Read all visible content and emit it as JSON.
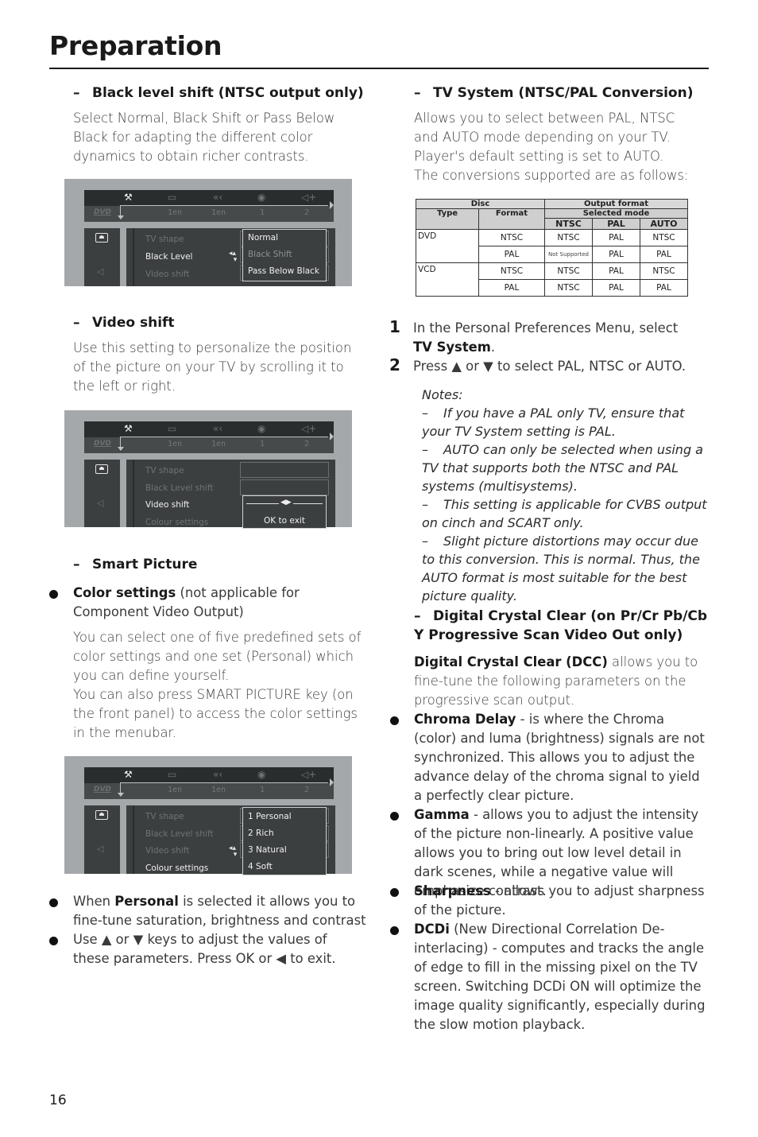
{
  "header": {
    "title": "Preparation"
  },
  "left": {
    "black_level": {
      "heading": "Black level shift (NTSC output only)",
      "body": "Select Normal, Black Shift or Pass Below Black for adapting the different color dynamics to obtain richer contrasts."
    },
    "video_shift": {
      "heading": "Video shift",
      "body": "Use this setting to personalize the position of the picture on your TV by scrolling it to the left or right."
    },
    "smart_picture": {
      "heading": "Smart Picture",
      "bullet_bold": "Color settings",
      "bullet_rest": " (not applicable for Component Video Output)",
      "body1": "You can select one of five predefined sets of color settings and one set (Personal) which you can define yourself.",
      "body2": "You can also press SMART PICTURE key (on the front panel) to access the color settings in the menubar."
    },
    "bullets": [
      {
        "pre": "When ",
        "bold": "Personal",
        "post": " is selected it allows you to fine-tune saturation, brightness and contrast"
      },
      {
        "pre": "Use ▲ or ▼ keys to adjust the values of these parameters. Press OK or ◀ to exit.",
        "bold": "",
        "post": ""
      }
    ]
  },
  "osd": {
    "menubar_icons": [
      "settings-icon",
      "subtitle-icon",
      "audio-language-icon",
      "angle-icon",
      "audio-output-icon"
    ],
    "menubar_values": [
      "1en",
      "1en",
      "1",
      "2"
    ],
    "disc_label": "DVD",
    "screen1": {
      "items": [
        "TV shape",
        "Black Level",
        "Video shift"
      ],
      "selected_index": 1,
      "options": [
        "Normal",
        "Black Shift",
        "Pass Below Black"
      ],
      "highlighted_option": 1
    },
    "screen2": {
      "items": [
        "TV shape",
        "Black Level shift",
        "Video shift",
        "Colour settings"
      ],
      "selected_index": 2,
      "slider_label": "◀▶",
      "ok_label": "OK to exit"
    },
    "screen3": {
      "items": [
        "TV shape",
        "Black Level shift",
        "Video shift",
        "Colour settings"
      ],
      "selected_index": 3,
      "options": [
        "1 Personal",
        "2 Rich",
        "3 Natural",
        "4 Soft"
      ]
    }
  },
  "right": {
    "tv_system": {
      "heading": "TV System (NTSC/PAL Conversion)",
      "body": "Allows you to select between PAL, NTSC and AUTO mode depending on your TV. Player's default setting is set to AUTO.",
      "body2": "The conversions supported are as follows:"
    },
    "table": {
      "group_disc": "Disc",
      "group_output": "Output format",
      "col_type": "Type",
      "col_format": "Format",
      "selected_mode": "Selected mode",
      "modes": [
        "NTSC",
        "PAL",
        "AUTO"
      ],
      "rows": [
        {
          "type": "DVD",
          "format": "NTSC",
          "values": [
            "NTSC",
            "PAL",
            "NTSC"
          ]
        },
        {
          "type": "",
          "format": "PAL",
          "values": [
            "Not Supported",
            "PAL",
            "PAL"
          ]
        },
        {
          "type": "VCD",
          "format": "NTSC",
          "values": [
            "NTSC",
            "PAL",
            "NTSC"
          ]
        },
        {
          "type": "",
          "format": "PAL",
          "values": [
            "NTSC",
            "PAL",
            "PAL"
          ]
        }
      ]
    },
    "steps": [
      {
        "num": "1",
        "pre": "In the Personal Preferences Menu, select ",
        "bold": "TV System",
        "post": "."
      },
      {
        "num": "2",
        "pre": "Press ▲ or ▼ to select PAL, NTSC or AUTO.",
        "bold": "",
        "post": ""
      }
    ],
    "notes": {
      "title": "Notes:",
      "items": [
        "If you have a PAL only TV, ensure that your TV System setting is PAL.",
        "AUTO can only be selected when using a TV that supports both the NTSC and PAL systems (multisystems).",
        "This setting is applicable for CVBS output on cinch and SCART only.",
        "Slight picture distortions may occur due to this conversion. This is normal. Thus, the AUTO format is most suitable for the best picture quality."
      ]
    },
    "dcc": {
      "heading": "Digital Crystal Clear (on Pr/Cr Pb/Cb Y Progressive Scan Video Out only)",
      "intro_bold": "Digital Crystal Clear (DCC)",
      "intro_rest": " allows you to fine-tune the following parameters on the progressive scan output.",
      "bullets": [
        {
          "bold": "Chroma Delay",
          "rest": " - is where the Chroma (color) and luma (brightness) signals are not synchronized. This allows you to adjust the advance delay of the chroma signal to yield a perfectly clear picture."
        },
        {
          "bold": "Gamma",
          "rest": " - allows you to adjust the intensity of the picture non-linearly. A positive value allows you to bring out low level detail in dark scenes, while a negative value will emphasize contrast."
        },
        {
          "bold": "Sharpness",
          "rest": " - allows you to adjust sharpness of the picture."
        },
        {
          "bold": "DCDi",
          "rest": " (New Directional Correlation De-interlacing) - computes and tracks the angle of edge to fill in the missing pixel on the TV screen. Switching DCDi ON will optimize the image quality significantly, especially during the slow motion playback."
        }
      ]
    }
  },
  "footer": {
    "page_number": "16"
  }
}
